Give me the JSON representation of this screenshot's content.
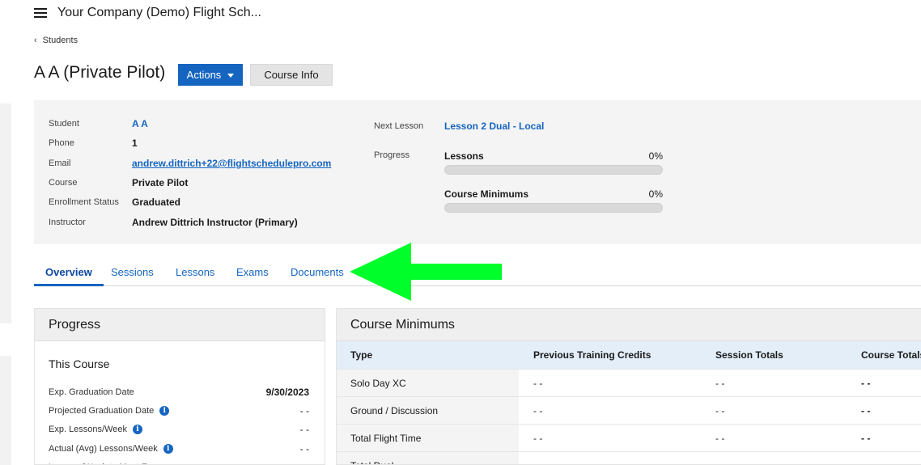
{
  "app": {
    "title": "Your Company (Demo) Flight Sch..."
  },
  "breadcrumb": {
    "label": "Students"
  },
  "page": {
    "title": "A A (Private Pilot)"
  },
  "buttons": {
    "actions": "Actions",
    "course_info": "Course Info"
  },
  "student_info": [
    {
      "label": "Student",
      "value": "A A",
      "style": "link"
    },
    {
      "label": "Phone",
      "value": "1",
      "style": "plain"
    },
    {
      "label": "Email",
      "value": "andrew.dittrich+22@flightschedulepro.com",
      "style": "email"
    },
    {
      "label": "Course",
      "value": "Private Pilot",
      "style": "plain"
    },
    {
      "label": "Enrollment Status",
      "value": "Graduated",
      "style": "plain"
    },
    {
      "label": "Instructor",
      "value": "Andrew Dittrich Instructor (Primary)",
      "style": "plain"
    }
  ],
  "next_lesson": {
    "label": "Next Lesson",
    "value": "Lesson 2 Dual - Local"
  },
  "progress": {
    "label": "Progress",
    "items": [
      {
        "name": "Lessons",
        "percent_text": "0%",
        "fraction": 0
      },
      {
        "name": "Course Minimums",
        "percent_text": "0%",
        "fraction": 0
      }
    ]
  },
  "tabs": [
    {
      "label": "Overview",
      "active": true
    },
    {
      "label": "Sessions",
      "active": false
    },
    {
      "label": "Lessons",
      "active": false
    },
    {
      "label": "Exams",
      "active": false
    },
    {
      "label": "Documents",
      "active": false
    }
  ],
  "annotation": {
    "arrow_color": "#00ff2a"
  },
  "progress_card": {
    "title": "Progress",
    "subtitle": "This Course",
    "rows": [
      {
        "label": "Exp. Graduation Date",
        "value": "9/30/2023",
        "info": false,
        "bold": true
      },
      {
        "label": "Projected Graduation Date",
        "value": "- -",
        "info": true,
        "bold": false
      },
      {
        "label": "Exp. Lessons/Week",
        "value": "- -",
        "info": true,
        "bold": false
      },
      {
        "label": "Actual (Avg) Lessons/Week",
        "value": "- -",
        "info": true,
        "bold": false
      },
      {
        "label": "Lessons/Week to Meet Exp...",
        "value": "",
        "info": false,
        "bold": false
      }
    ]
  },
  "course_minimums": {
    "title": "Course Minimums",
    "columns": [
      "Type",
      "Previous Training Credits",
      "Session Totals",
      "Course Totals"
    ],
    "rows": [
      [
        "Solo Day XC",
        "- -",
        "- -",
        "- -"
      ],
      [
        "Ground / Discussion",
        "- -",
        "- -",
        "- -"
      ],
      [
        "Total Flight Time",
        "- -",
        "- -",
        "- -"
      ],
      [
        "Total Dual",
        "- -",
        "- -",
        "- -"
      ]
    ]
  },
  "colors": {
    "accent": "#1565c0",
    "panel_bg": "#f4f4f4",
    "table_header_bg": "#e3eef8"
  }
}
